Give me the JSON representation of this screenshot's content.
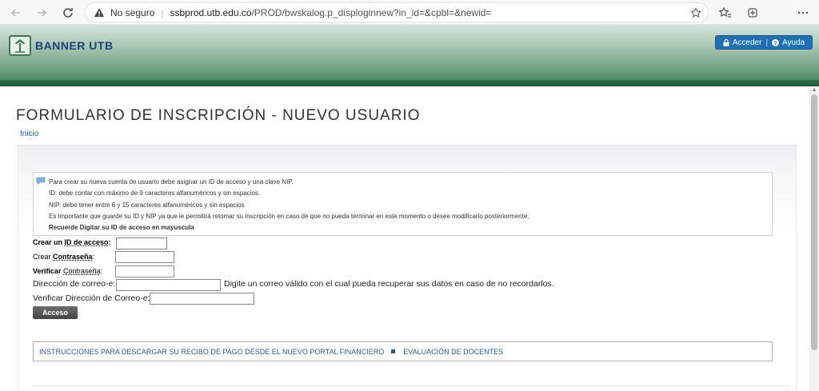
{
  "browser": {
    "security_label": "No seguro",
    "url_host": "ssbprod.utb.edu.co",
    "url_path": "/PROD/bwskalog.p_disploginnew?in_id=&cpbl=&newid="
  },
  "header": {
    "logo_text": "BANNER UTB",
    "login_label": "Acceder",
    "separator": "|",
    "help_label": "Ayuda"
  },
  "page": {
    "title": "FORMULARIO DE INSCRIPCIÓN - NUEVO USUARIO",
    "home_link": "Inicio"
  },
  "info": {
    "lines": [
      "Para crear su nueva cuenta de usuario debe asignar un ID de acceso y una clave NIP.",
      "ID: debe contar con máximo de 9 caracteres alfanuméricos y sin espacios.",
      "NIP: debe tener entre 6 y 15 caracteres alfanuméricos y sin espacios",
      "Es importante que guarde su ID y NIP ya que le permitirá retomar su inscripción en caso de que no pueda terminar en este momento o desee modificarlo posteriormente.",
      "Recuerde Digitar su ID de acceso en mayuscula"
    ]
  },
  "form": {
    "create_id_prefix": "Crear un",
    "create_id_term": "ID de acceso",
    "create_id_suffix": ":",
    "create_pw_prefix": "Crear",
    "create_pw_term": "Contraseña",
    "create_pw_suffix": ":",
    "verify_pw_prefix": "Verificar",
    "verify_pw_term": "Contraseña",
    "verify_pw_suffix": ":",
    "email_label": "Dirección de correo-e:",
    "email_hint": "Digite un correo válido con el cual pueda recuperar sus datos en caso de no recordarlos.",
    "verify_email_label": "Verificar Dirección de Correo-e:",
    "submit_label": "Acceso"
  },
  "links": {
    "instructions": "INSTRUCCIONES PARA DESCARGAR SU RECIBO DE PAGO DESDE EL NUEVO PORTAL FINANCIERO",
    "evaluation": "EVALUACIÓN DE DOCENTES"
  },
  "colors": {
    "link": "#2b5c9b",
    "header_button": "#1f6fb5",
    "banner_green": "#3f7e5a"
  }
}
